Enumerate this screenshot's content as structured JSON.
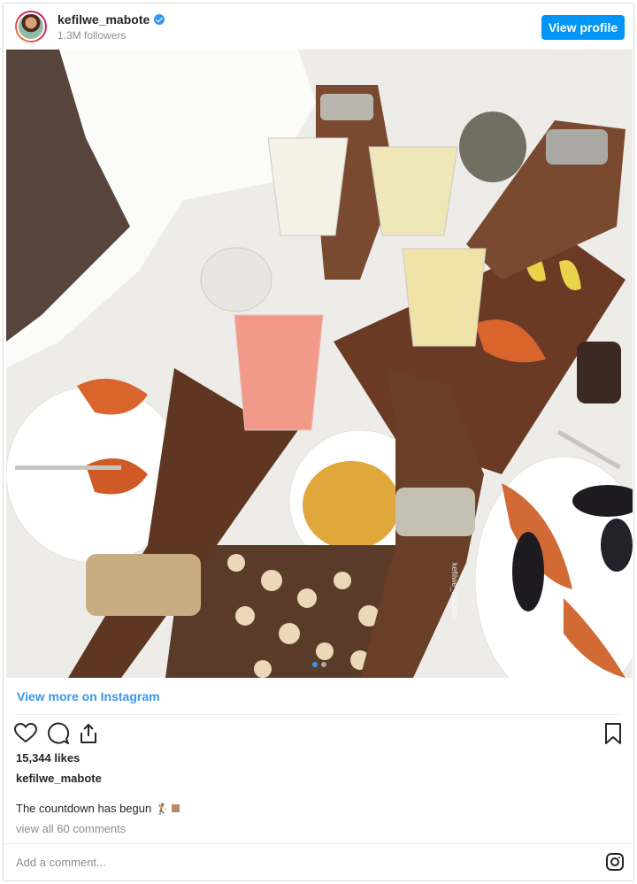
{
  "header": {
    "username": "kefilwe_mabote",
    "followers": "1.3M followers",
    "view_profile_label": "View profile"
  },
  "photo": {
    "watermark": "kefilwe_mabote",
    "carousel_dots": 2
  },
  "post": {
    "view_more_label": "View more on Instagram",
    "likes": "15,344 likes",
    "caption_user": "kefilwe_mabote",
    "caption_text": "The countdown has begun",
    "caption_emoji": "🏌",
    "view_comments": "view all 60 comments"
  },
  "comment_box": {
    "placeholder": "Add a comment..."
  },
  "icons": {
    "like": "heart-icon",
    "comment": "comment-icon",
    "share": "share-icon",
    "save": "bookmark-icon",
    "brand": "instagram-icon",
    "verified": "verified-badge-icon"
  },
  "colors": {
    "accent": "#3897f0",
    "button": "#0095f6",
    "text": "#262626",
    "muted": "#8e8e8e",
    "border": "#dbdbdb"
  }
}
